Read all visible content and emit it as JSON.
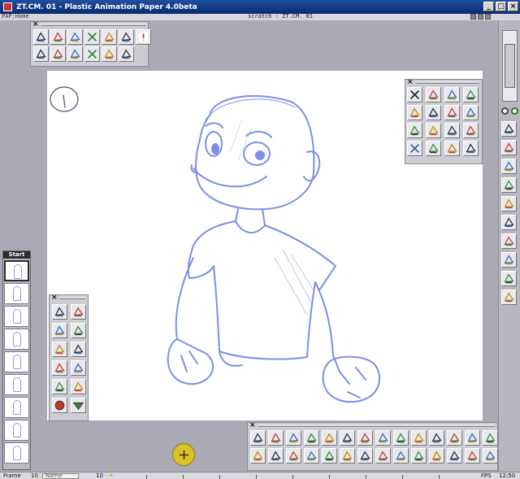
{
  "window": {
    "title": "ZT.CM. 01 - Plastic Animation Paper 4.0beta",
    "controls": [
      "minimize",
      "maximize",
      "close"
    ]
  },
  "menubar": {
    "path": "PAP:Home",
    "document": "scratch : ZT.CM. 01"
  },
  "top_toolbar": {
    "row1": [
      "onion-skin-icon",
      "onion-forward-icon",
      "light-table-icon",
      "cut-frame-icon",
      "copy-frame-icon",
      "paste-frame-icon",
      "alert-icon"
    ],
    "row2": [
      "key-frame-icon",
      "save-icon",
      "save-as-icon",
      "cut-save-icon",
      "copy-save-icon",
      "sound-icon"
    ]
  },
  "right_panel": {
    "tools": [
      "cut-icon",
      "copy-icon",
      "paste-icon",
      "hand-icon",
      "flip-horizontal-icon",
      "rotate-icon",
      "color-fill-icon",
      "trash-icon",
      "flip-vertical-icon",
      "rotate-left-icon",
      "rotate-right-icon",
      "duplicate-icon",
      "cut-selection-icon",
      "copy-selection-icon",
      "paste-selection-icon",
      "clear-selection-icon"
    ]
  },
  "left_panel": {
    "tools": [
      "rotate-cw-icon",
      "rotate-ccw-icon",
      "shrink-h-icon",
      "expand-h-icon",
      "shrink-v-icon",
      "expand-v-icon",
      "loop-start-icon",
      "loop-end-icon",
      "onion-up-icon",
      "onion-down-icon",
      "traffic-red-icon",
      "traffic-green-icon"
    ]
  },
  "bottom_panel": {
    "tools": [
      "pen-tool-icon",
      "pencil-tool-icon",
      "brush-tool-icon",
      "help-pen-icon",
      "help-brush-icon",
      "help-color-icon",
      "erase-icon",
      "fill-icon",
      "mask-icon",
      "key-icon",
      "key-plus-icon",
      "key-minus-icon",
      "dots-icon",
      "grid-icon",
      "line-tool-icon",
      "curve-tool-icon",
      "stroke-tool-icon",
      "slant-tool-icon",
      "bottle-tool-icon",
      "ruler-tool-icon",
      "shape-tool-icon",
      "add-layer-icon",
      "layer-down-icon",
      "layer-up-icon",
      "layer-swap-icon",
      "layer-color-icon",
      "sound-wave-icon",
      "options-icon"
    ]
  },
  "right_sidebar": {
    "tools": [
      "pen-brush-icon",
      "color-brush-icon",
      "eraser-icon",
      "line-icon",
      "gear-arrow-icon",
      "play-forward-icon",
      "play-backward-icon",
      "play-loop-icon",
      "record-icon",
      "export-icon"
    ]
  },
  "film_strip": {
    "header": "Start",
    "frame_count": 9,
    "selected_index": 0
  },
  "canvas": {
    "page_number": "1"
  },
  "statusbar": {
    "left_label": "Frame",
    "frame_value": "10",
    "name_label": "Name",
    "duration_value": "10",
    "fps_label": "FPS",
    "time": "12:50"
  },
  "colors": {
    "titlebar": "#0f3a8a",
    "workspace": "#a9aab3",
    "panel": "#ccccd3",
    "sketch_stroke": "#7b8fe6",
    "cursor_highlight": "#d8c227"
  }
}
